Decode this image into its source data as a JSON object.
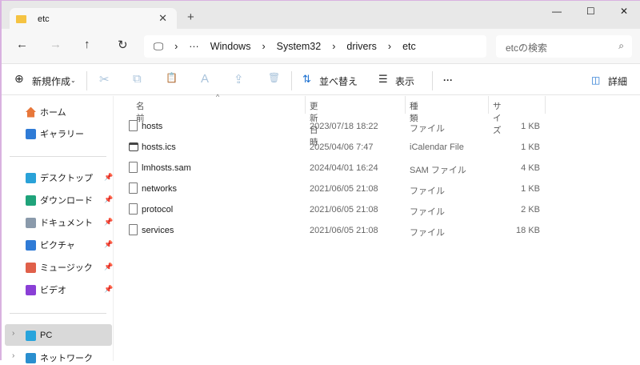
{
  "tab": {
    "title": "etc",
    "close": "✕",
    "new": "+"
  },
  "window": {
    "minimize": "—",
    "maximize": "☐",
    "close": "✕"
  },
  "nav": {
    "back": "←",
    "forward": "→",
    "up": "↑",
    "refresh": "↻"
  },
  "breadcrumb": {
    "pc_icon": "🖵",
    "sep": "›",
    "more": "···",
    "items": [
      "Windows",
      "System32",
      "drivers",
      "etc"
    ]
  },
  "search": {
    "placeholder": "etcの検索",
    "icon": "⌕"
  },
  "toolbar": {
    "new": "新規作成",
    "cut": "✂",
    "copy": "⧉",
    "paste": "📋",
    "rename": "A",
    "share": "⇪",
    "delete": "🗑",
    "sort": "並べ替え",
    "view": "表示",
    "more": "···",
    "details": "詳細"
  },
  "sidebar": {
    "home": "ホーム",
    "gallery": "ギャラリー",
    "pinned": [
      {
        "label": "デスクトップ",
        "color": "#2aa2d8"
      },
      {
        "label": "ダウンロード",
        "color": "#1fa37a"
      },
      {
        "label": "ドキュメント",
        "color": "#8a9aab"
      },
      {
        "label": "ピクチャ",
        "color": "#2f7bd6"
      },
      {
        "label": "ミュージック",
        "color": "#e0604a"
      },
      {
        "label": "ビデオ",
        "color": "#8a3fd6"
      }
    ],
    "pc": "PC",
    "network": "ネットワーク"
  },
  "columns": {
    "name": "名前",
    "date": "更新日時",
    "type": "種類",
    "size": "サイズ"
  },
  "files": [
    {
      "name": "hosts",
      "date": "2023/07/18 18:22",
      "type": "ファイル",
      "size": "1 KB"
    },
    {
      "name": "hosts.ics",
      "date": "2025/04/06 7:47",
      "type": "iCalendar File",
      "size": "1 KB"
    },
    {
      "name": "lmhosts.sam",
      "date": "2024/04/01 16:24",
      "type": "SAM ファイル",
      "size": "4 KB"
    },
    {
      "name": "networks",
      "date": "2021/06/05 21:08",
      "type": "ファイル",
      "size": "1 KB"
    },
    {
      "name": "protocol",
      "date": "2021/06/05 21:08",
      "type": "ファイル",
      "size": "2 KB"
    },
    {
      "name": "services",
      "date": "2021/06/05 21:08",
      "type": "ファイル",
      "size": "18 KB"
    }
  ]
}
